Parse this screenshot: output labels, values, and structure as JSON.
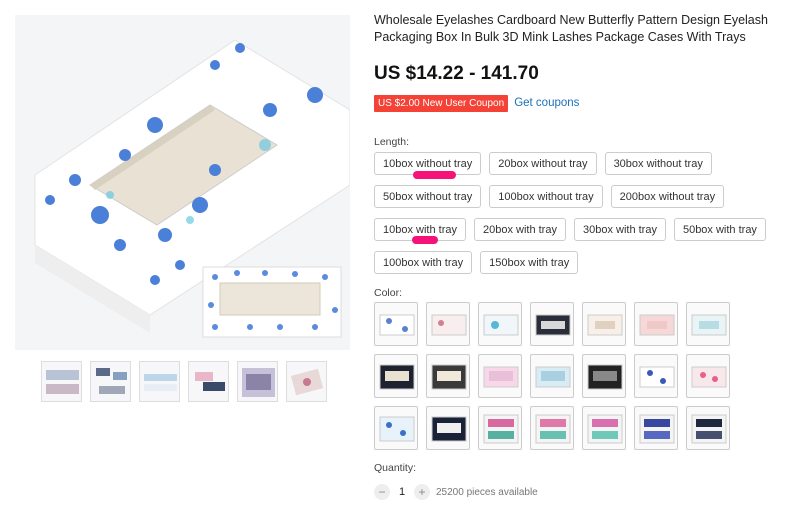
{
  "product": {
    "title": "Wholesale Eyelashes Cardboard New Butterfly Pattern Design Eyelash Packaging Box In Bulk 3D Mink Lashes Package Cases With Trays",
    "price": "US $14.22 - 141.70",
    "coupon_label": "US $2.00 New User Coupon",
    "get_coupons_label": "Get coupons"
  },
  "length": {
    "label": "Length:",
    "rows": [
      [
        "10box without tray",
        "20box without tray",
        "30box without tray"
      ],
      [
        "50box without tray",
        "100box without tray",
        "200box without tray"
      ],
      [
        "10box with tray",
        "20box with tray",
        "30box with tray",
        "50box with tray"
      ],
      [
        "100box with tray",
        "150box with tray"
      ]
    ]
  },
  "color": {
    "label": "Color:",
    "swatch_count": 21
  },
  "quantity": {
    "label": "Quantity:",
    "value": "1",
    "minus": "−",
    "plus": "+",
    "available": "25200 pieces available"
  },
  "colors": {
    "accent_red": "#f44336",
    "link_blue": "#1d6fb8",
    "highlight_mark": "#f5137a"
  }
}
